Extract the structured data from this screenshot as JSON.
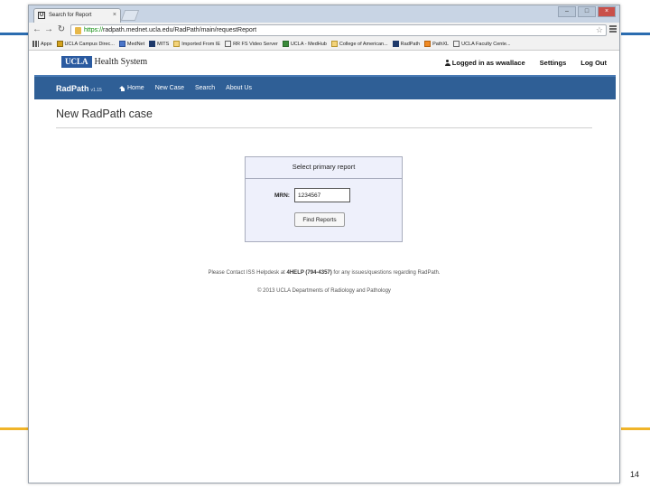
{
  "browser": {
    "tab_title": "Search for Report",
    "tab_favicon": "U",
    "url_scheme": "https://",
    "url_rest": "radpath.mednet.ucla.edu/RadPath/main/requestReport"
  },
  "bookmarks": [
    {
      "label": "Apps",
      "icon": "apps-icon"
    },
    {
      "label": "UCLA Campus Direc...",
      "icon": "yellow"
    },
    {
      "label": "MedNet",
      "icon": "blue"
    },
    {
      "label": "MITS",
      "icon": "dark"
    },
    {
      "label": "Imported From IE",
      "icon": "folder"
    },
    {
      "label": "RR FS Video Server",
      "icon": "page"
    },
    {
      "label": "UCLA - MedHub",
      "icon": "green"
    },
    {
      "label": "College of American...",
      "icon": "folder"
    },
    {
      "label": "RadPath",
      "icon": "dark"
    },
    {
      "label": "PathXL",
      "icon": "orange"
    },
    {
      "label": "UCLA Faculty Cente...",
      "icon": "page"
    }
  ],
  "site": {
    "logo_box": "UCLA",
    "logo_text": "Health System",
    "user_label": "Logged in as wwallace",
    "settings_label": "Settings",
    "logout_label": "Log Out"
  },
  "navbar": {
    "brand": "RadPath",
    "version": "v1.15",
    "home": "Home",
    "new_case": "New Case",
    "search": "Search",
    "about": "About Us"
  },
  "page": {
    "title": "New RadPath case",
    "panel_heading": "Select primary report",
    "mrn_label": "MRN:",
    "mrn_value": "1234567",
    "find_button": "Find Reports",
    "contact_pre": "Please Contact ISS Helpdesk at ",
    "contact_bold": "4HELP (794-4357)",
    "contact_post": " for any issues/questions regarding RadPath.",
    "copyright": "© 2013 UCLA Departments of Radiology and Pathology"
  },
  "slide": {
    "number": "14"
  },
  "colors": {
    "navbar": "#2f5f96",
    "panel_bg": "#eef0fb",
    "accent_blue_line": "#2b6cb0",
    "accent_gold_line": "#f0b429"
  }
}
